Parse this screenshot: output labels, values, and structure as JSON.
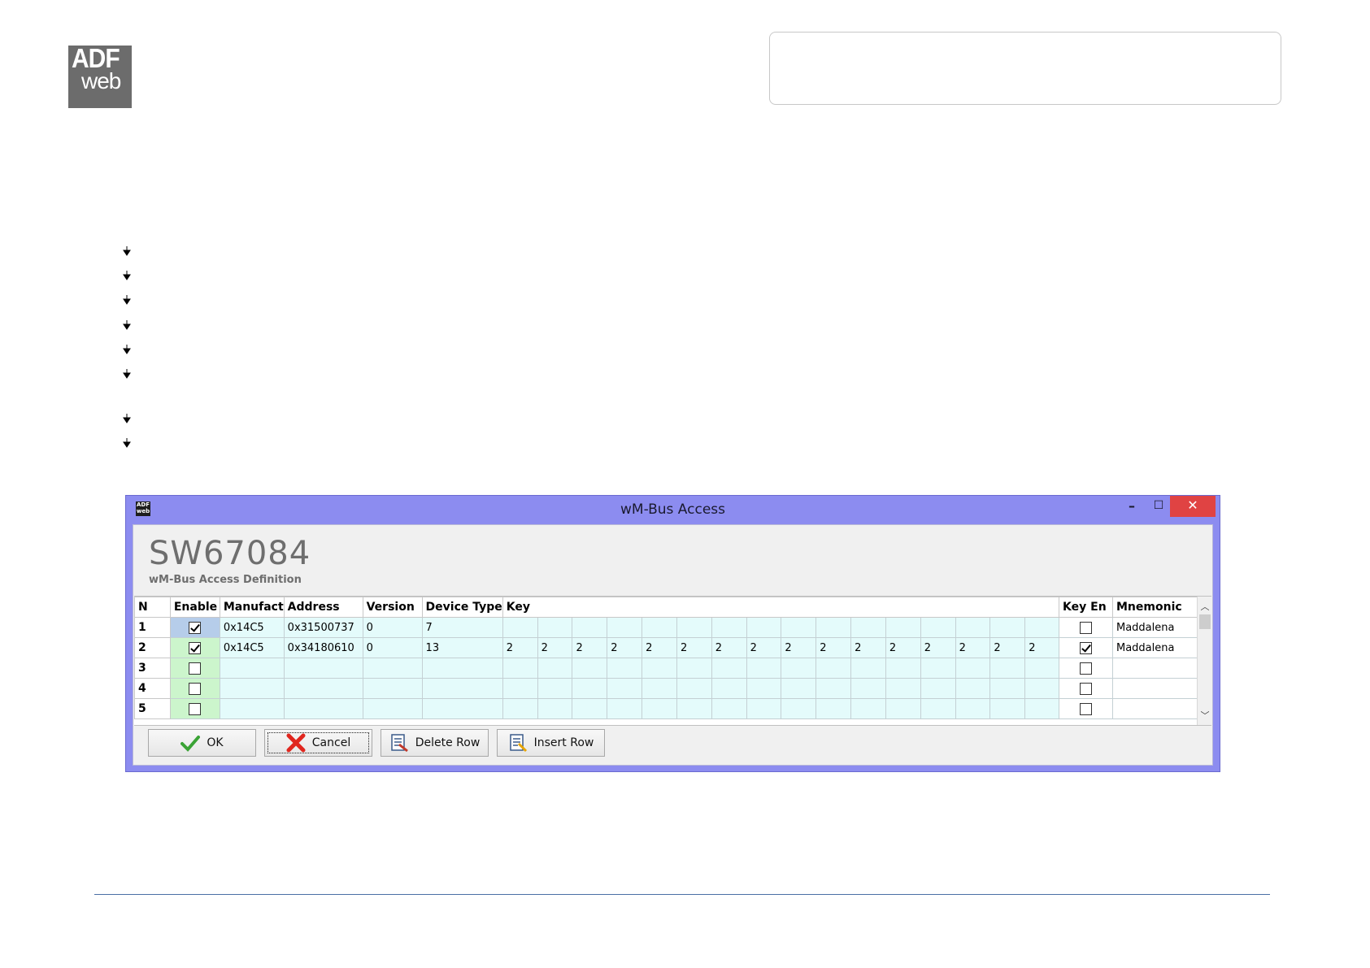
{
  "logo": {
    "line1": "ADF",
    "line2": "web"
  },
  "window": {
    "title": "wM-Bus Access",
    "app_icon_text": "ADF web",
    "min_glyph": "–",
    "max_glyph": "☐",
    "close_glyph": "✕",
    "product": "SW67084",
    "subtitle": "wM-Bus Access Definition"
  },
  "table": {
    "headers": [
      "N",
      "Enable",
      "Manufact",
      "Address",
      "Version",
      "Device Type",
      "Key",
      "Key En",
      "Mnemonic"
    ],
    "rows": [
      {
        "n": "1",
        "enable": true,
        "manufact": "0x14C5",
        "address": "0x31500737",
        "version": "0",
        "device_type": "7",
        "key": [
          "",
          "",
          "",
          "",
          "",
          "",
          "",
          "",
          "",
          "",
          "",
          "",
          "",
          "",
          "",
          ""
        ],
        "key_en": false,
        "mnemonic": "Maddalena",
        "selected": true
      },
      {
        "n": "2",
        "enable": true,
        "manufact": "0x14C5",
        "address": "0x34180610",
        "version": "0",
        "device_type": "13",
        "key": [
          "2",
          "2",
          "2",
          "2",
          "2",
          "2",
          "2",
          "2",
          "2",
          "2",
          "2",
          "2",
          "2",
          "2",
          "2",
          "2"
        ],
        "key_en": true,
        "mnemonic": "Maddalena",
        "selected": false
      },
      {
        "n": "3",
        "enable": false,
        "manufact": "",
        "address": "",
        "version": "",
        "device_type": "",
        "key": [
          "",
          "",
          "",
          "",
          "",
          "",
          "",
          "",
          "",
          "",
          "",
          "",
          "",
          "",
          "",
          ""
        ],
        "key_en": false,
        "mnemonic": "",
        "selected": false
      },
      {
        "n": "4",
        "enable": false,
        "manufact": "",
        "address": "",
        "version": "",
        "device_type": "",
        "key": [
          "",
          "",
          "",
          "",
          "",
          "",
          "",
          "",
          "",
          "",
          "",
          "",
          "",
          "",
          "",
          ""
        ],
        "key_en": false,
        "mnemonic": "",
        "selected": false
      },
      {
        "n": "5",
        "enable": false,
        "manufact": "",
        "address": "",
        "version": "",
        "device_type": "",
        "key": [
          "",
          "",
          "",
          "",
          "",
          "",
          "",
          "",
          "",
          "",
          "",
          "",
          "",
          "",
          "",
          ""
        ],
        "key_en": false,
        "mnemonic": "",
        "selected": false
      }
    ]
  },
  "buttons": {
    "ok": "OK",
    "cancel": "Cancel",
    "delete_row": "Delete Row",
    "insert_row": "Insert Row"
  },
  "scroll": {
    "up": "︿",
    "down": "﹀"
  },
  "colors": {
    "window_frame": "#8c8cf0",
    "close_button": "#e04343",
    "enable_cell": "#ccf5cc",
    "data_cell": "#e4fbfb",
    "selected_cell": "#b6cdea"
  }
}
